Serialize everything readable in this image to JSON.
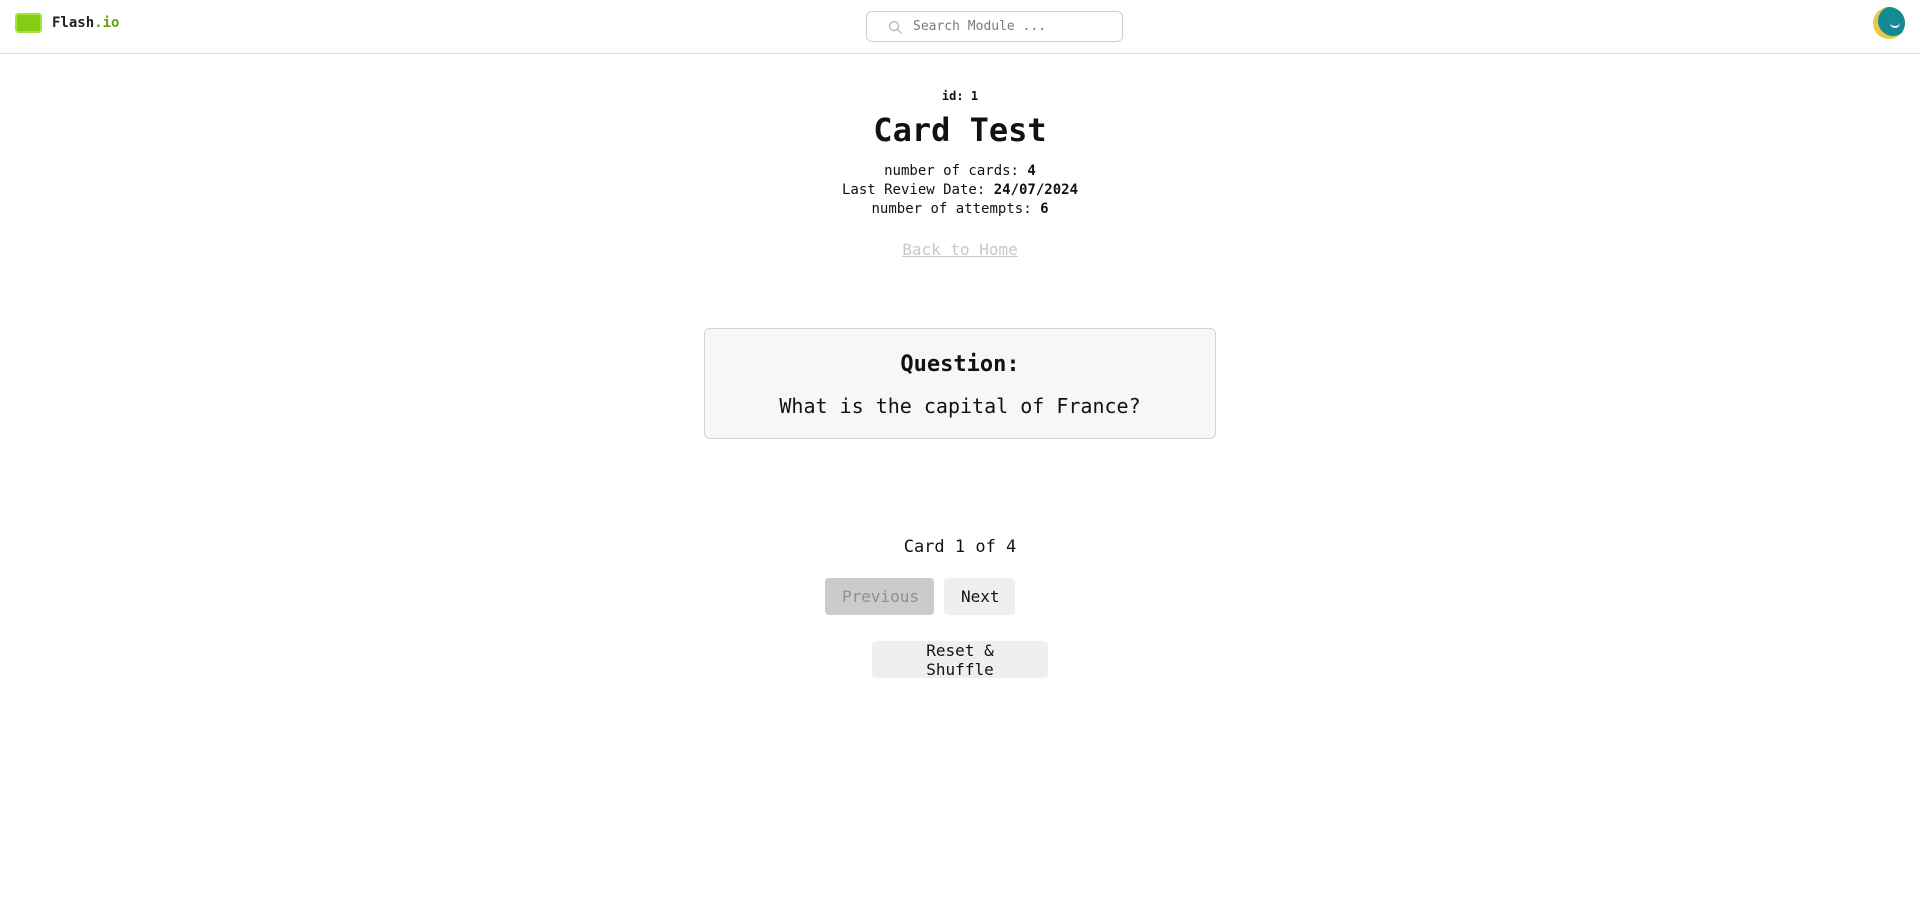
{
  "brand": {
    "name": "Flash",
    "accent": ".io",
    "logo_color": "#84cc16"
  },
  "search": {
    "placeholder": "Search Module ...",
    "icon": "search-icon"
  },
  "avatar": {
    "icon": "avatar-icon",
    "colors": [
      "#138a94",
      "#e6c84a"
    ]
  },
  "module": {
    "id_label": "id:",
    "id_value": "1",
    "title": "Card Test",
    "stats": [
      {
        "label": "number of cards:",
        "value": "4"
      },
      {
        "label": "Last Review Date:",
        "value": "24/07/2024"
      },
      {
        "label": "number of attempts:",
        "value": "6"
      }
    ],
    "back_link": "Back to Home"
  },
  "card": {
    "heading": "Question:",
    "text": "What is the capital of France?"
  },
  "pagination": {
    "counter": "Card 1 of 4",
    "previous_label": "Previous",
    "next_label": "Next",
    "previous_disabled": true
  },
  "actions": {
    "reset_label": "Reset & Shuffle"
  }
}
